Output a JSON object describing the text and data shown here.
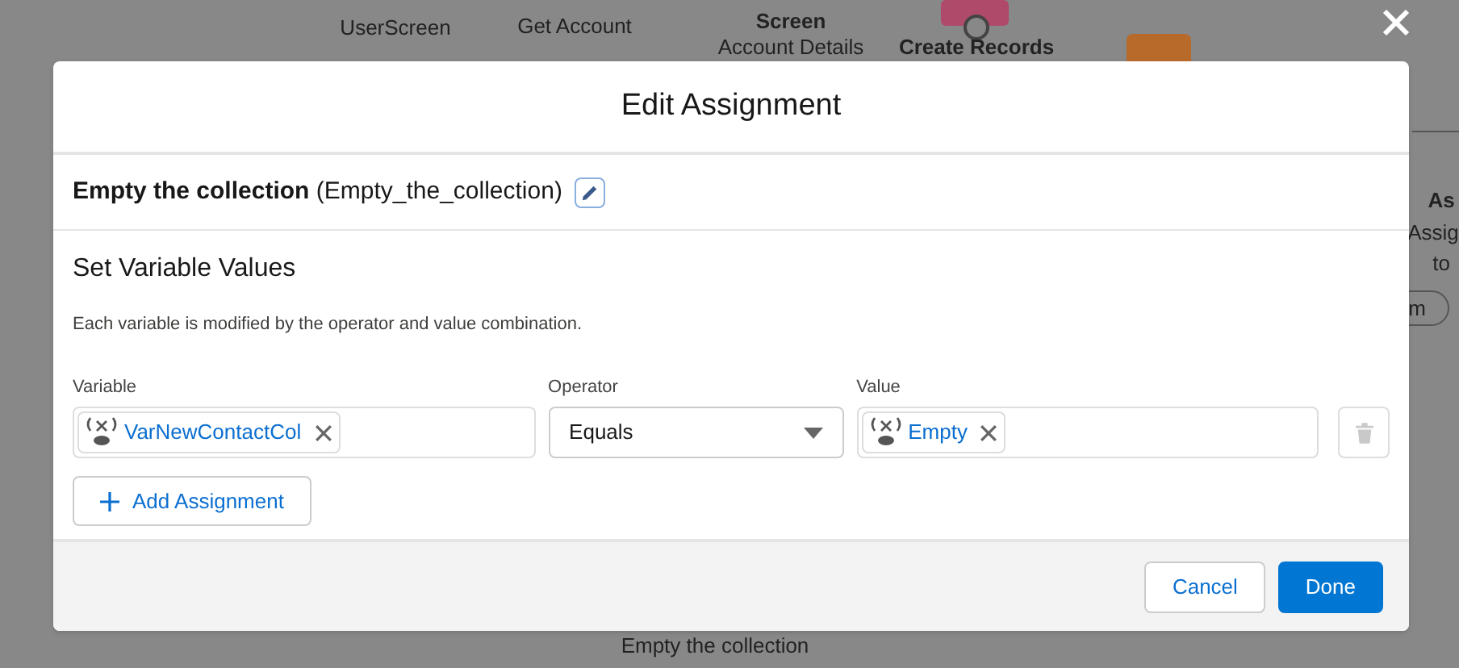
{
  "canvas": {
    "nodes": [
      {
        "label": "UserScreen",
        "bold": false
      },
      {
        "label": "Get Account",
        "bold": false
      },
      {
        "label": "Screen",
        "bold": true
      },
      {
        "label": "Account Details",
        "bold": false
      },
      {
        "label": "Create Records",
        "bold": true
      },
      {
        "label": "Empty the collection",
        "bold": false
      },
      {
        "label": "As",
        "bold": true
      },
      {
        "label": "Assig",
        "bold": false
      },
      {
        "label": "to",
        "bold": false
      },
      {
        "label": "m",
        "bold": false
      }
    ]
  },
  "modal": {
    "title": "Edit Assignment",
    "element": {
      "label": "Empty the collection",
      "api_name": "(Empty_the_collection)"
    },
    "section_title": "Set Variable Values",
    "description": "Each variable is modified by the operator and value combination.",
    "assignments": [
      {
        "variable_label": "Variable",
        "variable": "VarNewContactCol",
        "operator_label": "Operator",
        "operator": "Equals",
        "value_label": "Value",
        "value": "Empty"
      }
    ],
    "add_button": "Add Assignment",
    "buttons": [
      {
        "label": "Cancel",
        "kind": "neutral"
      },
      {
        "label": "Done",
        "kind": "brand"
      }
    ]
  }
}
